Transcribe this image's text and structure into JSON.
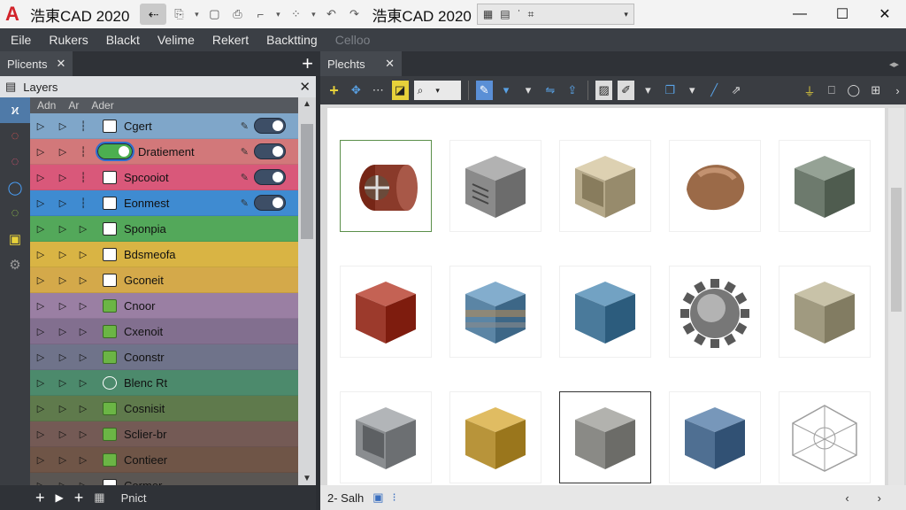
{
  "app": {
    "logo_letter": "A",
    "title": "浩東CAD 2020",
    "center_title": "浩東CAD 2020"
  },
  "window_controls": {
    "minimize": "—",
    "maximize": "☐",
    "close": "✕"
  },
  "menu": [
    {
      "label": "Eile",
      "dim": false
    },
    {
      "label": "Rukers",
      "dim": false
    },
    {
      "label": "Blackt",
      "dim": false
    },
    {
      "label": "Velime",
      "dim": false
    },
    {
      "label": "Rekert",
      "dim": false
    },
    {
      "label": "Backtting",
      "dim": false
    },
    {
      "label": "Celloo",
      "dim": true
    }
  ],
  "left_panel": {
    "tab_label": "Plicents",
    "layers_title": "Layers",
    "columns": [
      "Adn",
      "Ar",
      "Ader"
    ],
    "rows": [
      {
        "name": "Cgert",
        "bg": "#7fa6c9",
        "icon": "doc",
        "toggle": true
      },
      {
        "name": "Dratiement",
        "bg": "#d2787a",
        "icon": "green-toggle",
        "toggle": true
      },
      {
        "name": "Spcooiot",
        "bg": "#d9587a",
        "icon": "doc",
        "toggle": true
      },
      {
        "name": "Eonmest",
        "bg": "#3f8bd1",
        "icon": "doc",
        "toggle": true
      },
      {
        "name": "Sponpia",
        "bg": "#53a85a",
        "icon": "doc",
        "toggle": false
      },
      {
        "name": "Bdsmeofa",
        "bg": "#d9b444",
        "icon": "doc",
        "toggle": false
      },
      {
        "name": "Gconeit",
        "bg": "#d4a94a",
        "icon": "doc",
        "toggle": false
      },
      {
        "name": "Cnoor",
        "bg": "#9a7fa3",
        "icon": "green",
        "toggle": false
      },
      {
        "name": "Cxenoit",
        "bg": "#826f8f",
        "icon": "green",
        "toggle": false
      },
      {
        "name": "Coonstr",
        "bg": "#6f738a",
        "icon": "green",
        "toggle": false
      },
      {
        "name": "Blenc Rt",
        "bg": "#4c8a6c",
        "icon": "circle",
        "toggle": false
      },
      {
        "name": "Cosnisit",
        "bg": "#5f7a4c",
        "icon": "green",
        "toggle": false
      },
      {
        "name": "Sclier-br",
        "bg": "#745a55",
        "icon": "green",
        "toggle": false
      },
      {
        "name": "Contieer",
        "bg": "#6f5547",
        "icon": "green",
        "toggle": false
      },
      {
        "name": "Cormer",
        "bg": "#5a5653",
        "icon": "doc",
        "toggle": false
      }
    ],
    "bottom_label": "Pnict"
  },
  "right_panel": {
    "tab_label": "Plechts",
    "search_value": "",
    "status_text": "2- Salh",
    "tiles": [
      {
        "kind": "cylinder",
        "color": "#8a3a2a"
      },
      {
        "kind": "cube-vent",
        "color": "#8a8a8a"
      },
      {
        "kind": "cube-open",
        "color": "#b5a98a"
      },
      {
        "kind": "blob",
        "color": "#9b6a48"
      },
      {
        "kind": "cube",
        "color": "#6d7a6d"
      },
      {
        "kind": "cube",
        "color": "#9c3a2c"
      },
      {
        "kind": "cube-striped",
        "color": "#5b85a5"
      },
      {
        "kind": "cube",
        "color": "#4a7a9b"
      },
      {
        "kind": "gear",
        "color": "#777777"
      },
      {
        "kind": "cube",
        "color": "#a09a80"
      },
      {
        "kind": "cube-open",
        "color": "#8a8d90"
      },
      {
        "kind": "cube",
        "color": "#b8943a"
      },
      {
        "kind": "cube",
        "color": "#8a8a86"
      },
      {
        "kind": "cube",
        "color": "#4f6f92"
      },
      {
        "kind": "lattice",
        "color": "#c6c6c6"
      }
    ]
  }
}
